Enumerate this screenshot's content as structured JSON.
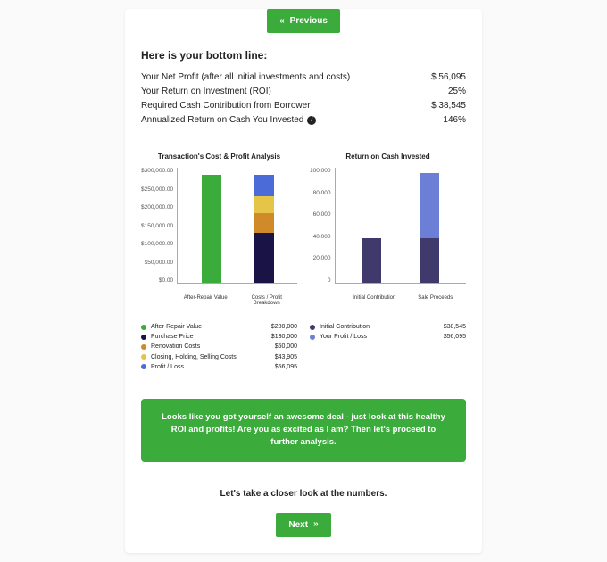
{
  "nav": {
    "previous": "Previous",
    "next": "Next"
  },
  "headline": "Here is your bottom line:",
  "metrics": [
    {
      "label": "Your Net Profit (after all initial investments and costs)",
      "value": "$ 56,095",
      "info": false
    },
    {
      "label": "Your Return on Investment (ROI)",
      "value": "25%",
      "info": false
    },
    {
      "label": "Required Cash Contribution from Borrower",
      "value": "$ 38,545",
      "info": false
    },
    {
      "label": "Annualized Return on Cash You Invested",
      "value": "146%",
      "info": true
    }
  ],
  "colors": {
    "green": "#3bab3b",
    "navy": "#1a1446",
    "orange": "#d08a2a",
    "gold": "#e4c547",
    "blue": "#4a6bd8",
    "purple": "#3f3a6b",
    "periwinkle": "#6c7fd6"
  },
  "chart_data": [
    {
      "type": "bar",
      "title": "Transaction's Cost & Profit Analysis",
      "ylabel": "",
      "ylim": [
        0,
        300000
      ],
      "yticks": [
        "$0.00",
        "$50,000.00",
        "$100,000.00",
        "$150,000.00",
        "$200,000.00",
        "$250,000.00",
        "$300,000.00"
      ],
      "categories": [
        "After-Repair Value",
        "Costs / Profit Breakdown"
      ],
      "bars": [
        {
          "category": "After-Repair Value",
          "segments": [
            {
              "name": "After-Repair Value",
              "value": 280000,
              "color_key": "green"
            }
          ]
        },
        {
          "category": "Costs / Profit Breakdown",
          "segments": [
            {
              "name": "Purchase Price",
              "value": 130000,
              "color_key": "navy"
            },
            {
              "name": "Renovation Costs",
              "value": 50000,
              "color_key": "orange"
            },
            {
              "name": "Closing, Holding, Selling Costs",
              "value": 43905,
              "color_key": "gold"
            },
            {
              "name": "Profit / Loss",
              "value": 56095,
              "color_key": "blue"
            }
          ]
        }
      ],
      "legend": [
        {
          "label": "After-Repair Value",
          "value": "$280,000",
          "color_key": "green"
        },
        {
          "label": "Purchase Price",
          "value": "$130,000",
          "color_key": "navy"
        },
        {
          "label": "Renovation Costs",
          "value": "$50,000",
          "color_key": "orange"
        },
        {
          "label": "Closing, Holding, Selling Costs",
          "value": "$43,905",
          "color_key": "gold"
        },
        {
          "label": "Profit / Loss",
          "value": "$56,095",
          "color_key": "blue"
        }
      ]
    },
    {
      "type": "bar",
      "title": "Return on Cash Invested",
      "ylabel": "",
      "ylim": [
        0,
        100000
      ],
      "yticks": [
        "0",
        "20,000",
        "40,000",
        "60,000",
        "80,000",
        "100,000"
      ],
      "categories": [
        "Initial Contribution",
        "Sale Proceeds"
      ],
      "bars": [
        {
          "category": "Initial Contribution",
          "segments": [
            {
              "name": "Initial Contribution",
              "value": 38545,
              "color_key": "purple"
            }
          ]
        },
        {
          "category": "Sale Proceeds",
          "segments": [
            {
              "name": "Initial Contribution",
              "value": 38545,
              "color_key": "purple"
            },
            {
              "name": "Your Profit / Loss",
              "value": 56095,
              "color_key": "periwinkle"
            }
          ]
        }
      ],
      "legend": [
        {
          "label": "Initial Contribution",
          "value": "$38,545",
          "color_key": "purple"
        },
        {
          "label": "Your Profit / Loss",
          "value": "$56,095",
          "color_key": "periwinkle"
        }
      ]
    }
  ],
  "banner": "Looks like you got yourself an awesome deal - just look at this healthy ROI and profits! Are you as excited as I am? Then let's proceed to further analysis.",
  "closer_look": "Let's take a closer look at the numbers."
}
